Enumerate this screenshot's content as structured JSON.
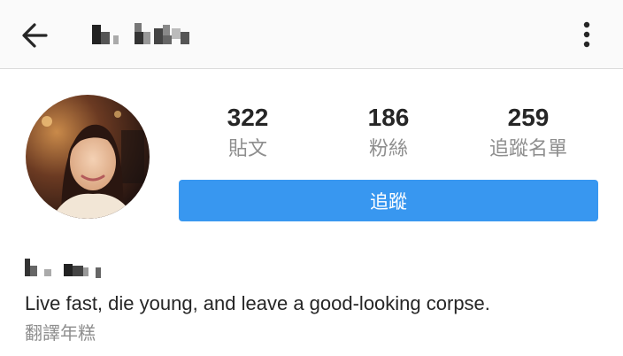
{
  "header": {
    "back_icon": "arrow-left-icon",
    "username_display": "pixelated",
    "more_icon": "more-vertical-icon"
  },
  "profile": {
    "stats": [
      {
        "count": "322",
        "label": "貼文"
      },
      {
        "count": "186",
        "label": "粉絲"
      },
      {
        "count": "259",
        "label": "追蹤名單"
      }
    ],
    "follow_label": "追蹤",
    "name_display": "pixelated",
    "bio": "Live fast, die young, and leave a good-looking corpse.",
    "translate_label": "翻譯年糕"
  },
  "colors": {
    "accent": "#3897f0",
    "text_primary": "#262626",
    "text_secondary": "#8e8e8e",
    "header_bg": "#fafafa"
  }
}
